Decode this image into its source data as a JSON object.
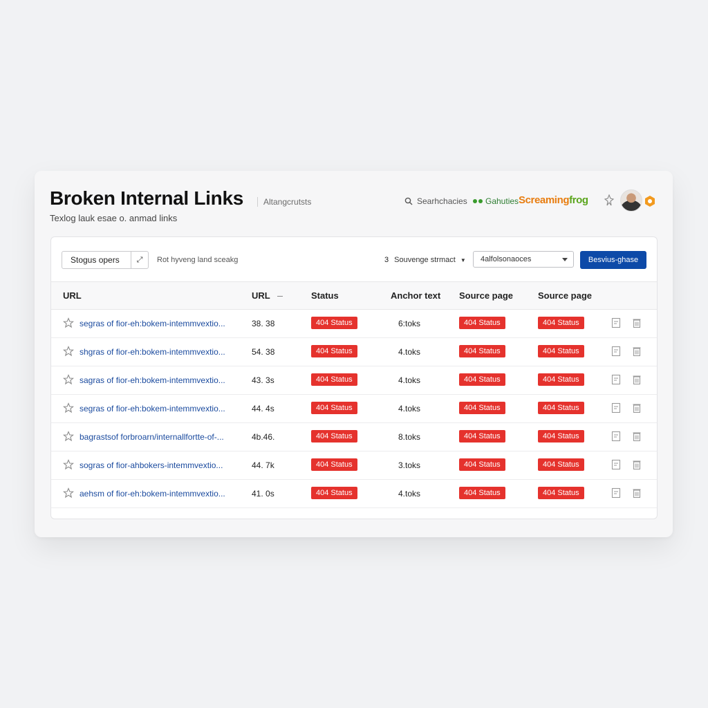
{
  "header": {
    "title": "Broken Internal Links",
    "tag": "Altangcrutsts",
    "subtitle": "Texlog lauk esae o. anmad links",
    "search_label": "Searhchacies",
    "gauthes_label": "Gahuties",
    "brand_part1": "Screaming",
    "brand_part2": "frog",
    "icons": {
      "search": "search-icon",
      "pin": "pin-icon",
      "settings": "hex-settings-icon"
    }
  },
  "toolbar": {
    "filter_value": "Stogus opers",
    "filter_hint": "Rot hyveng land sceakg",
    "count": "3",
    "count_label": "Souvenge strmact",
    "select_value": "4alfolsonaoces",
    "primary_button": "Besvius-ghase"
  },
  "table": {
    "headers": [
      "URL",
      "URL",
      "Status",
      "Anchor text",
      "Source page",
      "Source page"
    ],
    "rows": [
      {
        "url": "segras of fior-eh:bokem-intemmvextio...",
        "num": "38. 38",
        "status": "404 Status",
        "anchor": "6:toks",
        "src1": "404 Status",
        "src2": "404 Status"
      },
      {
        "url": "shgras of fior-eh:bokem-intemmvextio...",
        "num": "54. 38",
        "status": "404 Status",
        "anchor": "4.toks",
        "src1": "404 Status",
        "src2": "404 Status"
      },
      {
        "url": "sagras of fior-eh:bokem-intemmvextio...",
        "num": "43. 3s",
        "status": "404 Status",
        "anchor": "4.toks",
        "src1": "404 Status",
        "src2": "404 Status"
      },
      {
        "url": "segras of fior-eh:bokem-intemmvextio...",
        "num": "44. 4s",
        "status": "404 Status",
        "anchor": "4.toks",
        "src1": "404 Status",
        "src2": "404 Status"
      },
      {
        "url": "bagrastsof forbroarn/internallfortte-of-...",
        "num": "4b.46.",
        "status": "404 Status",
        "anchor": "8.toks",
        "src1": "404 Status",
        "src2": "404 Status"
      },
      {
        "url": "sogras of fior-ahbokers-intemmvextio...",
        "num": "44. 7k",
        "status": "404 Status",
        "anchor": "3.toks",
        "src1": "404 Status",
        "src2": "404 Status"
      },
      {
        "url": "aehsm of fior-eh:bokem-intemmvextio...",
        "num": "41. 0s",
        "status": "404 Status",
        "anchor": "4.toks",
        "src1": "404 Status",
        "src2": "404 Status"
      }
    ]
  },
  "colors": {
    "accent": "#0d4aa8",
    "status_error": "#e5322d",
    "link": "#1a4a9e",
    "brand_orange": "#e87d10",
    "brand_green": "#5ba51d"
  }
}
